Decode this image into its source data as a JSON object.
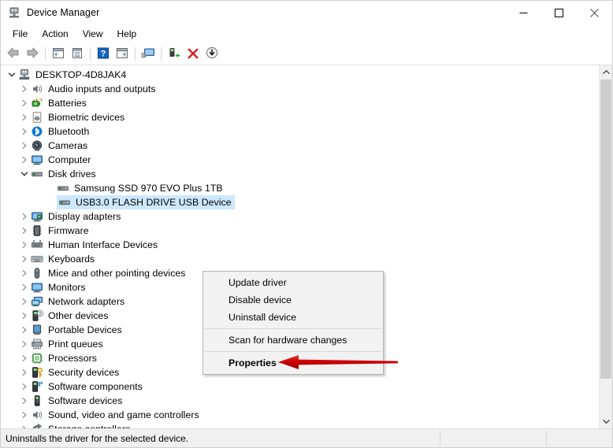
{
  "window": {
    "title": "Device Manager",
    "icon": "device-manager-icon",
    "controls": {
      "minimize": "Minimize",
      "maximize": "Maximize",
      "close": "Close"
    }
  },
  "menubar": {
    "items": [
      {
        "label": "File",
        "name": "menu-file"
      },
      {
        "label": "Action",
        "name": "menu-action"
      },
      {
        "label": "View",
        "name": "menu-view"
      },
      {
        "label": "Help",
        "name": "menu-help"
      }
    ]
  },
  "toolbar": {
    "buttons": [
      {
        "name": "back-button",
        "icon": "back-arrow-icon",
        "label": "Back"
      },
      {
        "name": "forward-button",
        "icon": "forward-arrow-icon",
        "label": "Forward"
      },
      {
        "name": "show-hide-console-tree-button",
        "icon": "console-tree-icon",
        "label": "Show/Hide Console Tree"
      },
      {
        "name": "properties-button",
        "icon": "properties-page-icon",
        "label": "Properties"
      },
      {
        "name": "help-button",
        "icon": "help-question-icon",
        "label": "Help"
      },
      {
        "name": "show-hide-action-pane-button",
        "icon": "action-pane-icon",
        "label": "Show/Hide Action Pane"
      },
      {
        "name": "scan-hardware-changes-button",
        "icon": "scan-monitor-icon",
        "label": "Scan for hardware changes"
      },
      {
        "name": "update-driver-button",
        "icon": "update-driver-icon",
        "label": "Update driver"
      },
      {
        "name": "uninstall-device-button",
        "icon": "red-x-icon",
        "label": "Uninstall device"
      },
      {
        "name": "disable-device-button",
        "icon": "disable-down-arrow-icon",
        "label": "Disable device"
      }
    ]
  },
  "tree": {
    "root": {
      "label": "DESKTOP-4D8JAK4",
      "icon": "computer-root-icon",
      "expanded": true,
      "depth": 0
    },
    "items": [
      {
        "label": "Audio inputs and outputs",
        "icon": "speaker-icon",
        "expanded": false,
        "depth": 1,
        "selected": false
      },
      {
        "label": "Batteries",
        "icon": "battery-icon",
        "expanded": false,
        "depth": 1,
        "selected": false
      },
      {
        "label": "Biometric devices",
        "icon": "fingerprint-icon",
        "expanded": false,
        "depth": 1,
        "selected": false
      },
      {
        "label": "Bluetooth",
        "icon": "bluetooth-icon",
        "expanded": false,
        "depth": 1,
        "selected": false
      },
      {
        "label": "Cameras",
        "icon": "camera-icon",
        "expanded": false,
        "depth": 1,
        "selected": false
      },
      {
        "label": "Computer",
        "icon": "monitor-icon",
        "expanded": false,
        "depth": 1,
        "selected": false
      },
      {
        "label": "Disk drives",
        "icon": "disk-drive-icon",
        "expanded": true,
        "depth": 1,
        "selected": false
      },
      {
        "label": "Samsung SSD 970 EVO Plus 1TB",
        "icon": "disk-drive-icon",
        "expanded": null,
        "depth": 2,
        "selected": false
      },
      {
        "label": "USB3.0 FLASH DRIVE USB Device",
        "icon": "disk-drive-icon",
        "expanded": null,
        "depth": 2,
        "selected": true
      },
      {
        "label": "Display adapters",
        "icon": "display-adapter-icon",
        "expanded": false,
        "depth": 1,
        "selected": false
      },
      {
        "label": "Firmware",
        "icon": "firmware-chip-icon",
        "expanded": false,
        "depth": 1,
        "selected": false
      },
      {
        "label": "Human Interface Devices",
        "icon": "hid-icon",
        "expanded": false,
        "depth": 1,
        "selected": false
      },
      {
        "label": "Keyboards",
        "icon": "keyboard-icon",
        "expanded": false,
        "depth": 1,
        "selected": false
      },
      {
        "label": "Mice and other pointing devices",
        "icon": "mouse-icon",
        "expanded": false,
        "depth": 1,
        "selected": false
      },
      {
        "label": "Monitors",
        "icon": "monitor-icon",
        "expanded": false,
        "depth": 1,
        "selected": false
      },
      {
        "label": "Network adapters",
        "icon": "network-adapter-icon",
        "expanded": false,
        "depth": 1,
        "selected": false
      },
      {
        "label": "Other devices",
        "icon": "other-device-question-icon",
        "expanded": false,
        "depth": 1,
        "selected": false
      },
      {
        "label": "Portable Devices",
        "icon": "portable-device-icon",
        "expanded": false,
        "depth": 1,
        "selected": false
      },
      {
        "label": "Print queues",
        "icon": "printer-icon",
        "expanded": false,
        "depth": 1,
        "selected": false
      },
      {
        "label": "Processors",
        "icon": "processor-icon",
        "expanded": false,
        "depth": 1,
        "selected": false
      },
      {
        "label": "Security devices",
        "icon": "security-key-icon",
        "expanded": false,
        "depth": 1,
        "selected": false
      },
      {
        "label": "Software components",
        "icon": "software-component-icon",
        "expanded": false,
        "depth": 1,
        "selected": false
      },
      {
        "label": "Software devices",
        "icon": "software-device-icon",
        "expanded": false,
        "depth": 1,
        "selected": false
      },
      {
        "label": "Sound, video and game controllers",
        "icon": "speaker-icon",
        "expanded": false,
        "depth": 1,
        "selected": false
      },
      {
        "label": "Storage controllers",
        "icon": "storage-controller-icon",
        "expanded": false,
        "depth": 1,
        "selected": false
      }
    ]
  },
  "context_menu": {
    "items": [
      {
        "label": "Update driver",
        "name": "context-update-driver",
        "bold": false
      },
      {
        "label": "Disable device",
        "name": "context-disable-device",
        "bold": false
      },
      {
        "label": "Uninstall device",
        "name": "context-uninstall-device",
        "bold": false
      },
      {
        "separator": true
      },
      {
        "label": "Scan for hardware changes",
        "name": "context-scan-hardware-changes",
        "bold": false
      },
      {
        "separator": true
      },
      {
        "label": "Properties",
        "name": "context-properties",
        "bold": true
      }
    ]
  },
  "annotation": {
    "type": "arrow",
    "color": "#cc0000",
    "points_to": "Properties"
  },
  "statusbar": {
    "message": "Uninstalls the driver for the selected device."
  },
  "colors": {
    "selection": "#cce8ff",
    "annotation_red": "#cc0000",
    "window_bg": "#ffffff",
    "chrome_bg": "#f0f0f0"
  }
}
